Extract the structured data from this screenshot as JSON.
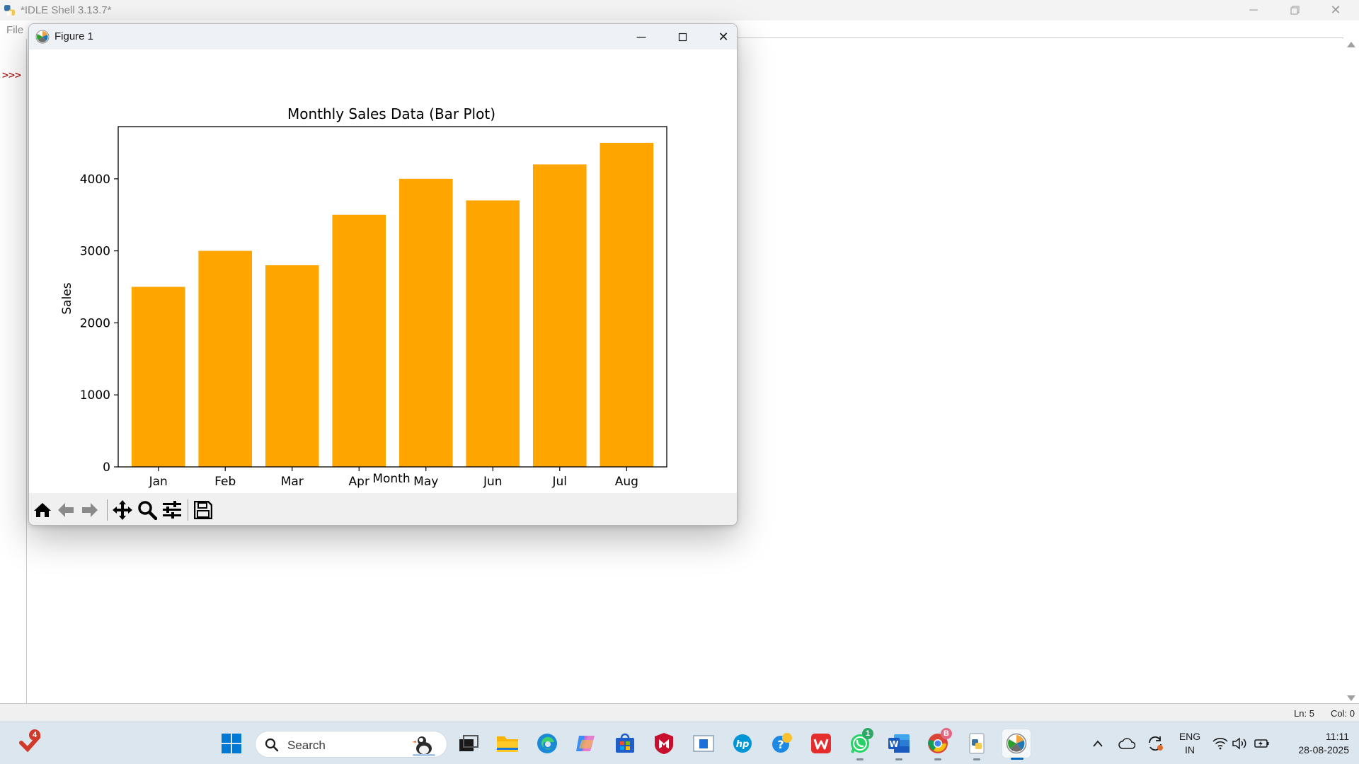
{
  "idle": {
    "title": "*IDLE Shell 3.13.7*",
    "menu_file": "File",
    "prompt": ">>>",
    "status_ln": "Ln: 5",
    "status_col": "Col: 0"
  },
  "figure": {
    "title": "Figure 1",
    "toolbar": [
      "home-icon",
      "back-arrow-icon",
      "forward-arrow-icon",
      "pan-icon",
      "zoom-icon",
      "configure-subplots-icon",
      "save-icon"
    ]
  },
  "chart_data": {
    "type": "bar",
    "title": "Monthly Sales Data (Bar Plot)",
    "xlabel": "Month",
    "ylabel": "Sales",
    "categories": [
      "Jan",
      "Feb",
      "Mar",
      "Apr",
      "May",
      "Jun",
      "Jul",
      "Aug"
    ],
    "values": [
      2500,
      3000,
      2800,
      3500,
      4000,
      3700,
      4200,
      4500
    ],
    "ylim": [
      0,
      4725
    ],
    "yticks": [
      0,
      1000,
      2000,
      3000,
      4000
    ],
    "bar_color": "#ffa500",
    "grid": false,
    "legend": "none"
  },
  "taskbar": {
    "search_placeholder": "Search",
    "notification_badge": "4",
    "whatsapp_badge": "1",
    "chrome_badge": "B",
    "language": "ENG",
    "region": "IN",
    "time": "11:11",
    "date": "28-08-2025"
  },
  "colors": {
    "accent": "#0067c0",
    "bar": "#ffa500",
    "prompt": "#a00000"
  }
}
